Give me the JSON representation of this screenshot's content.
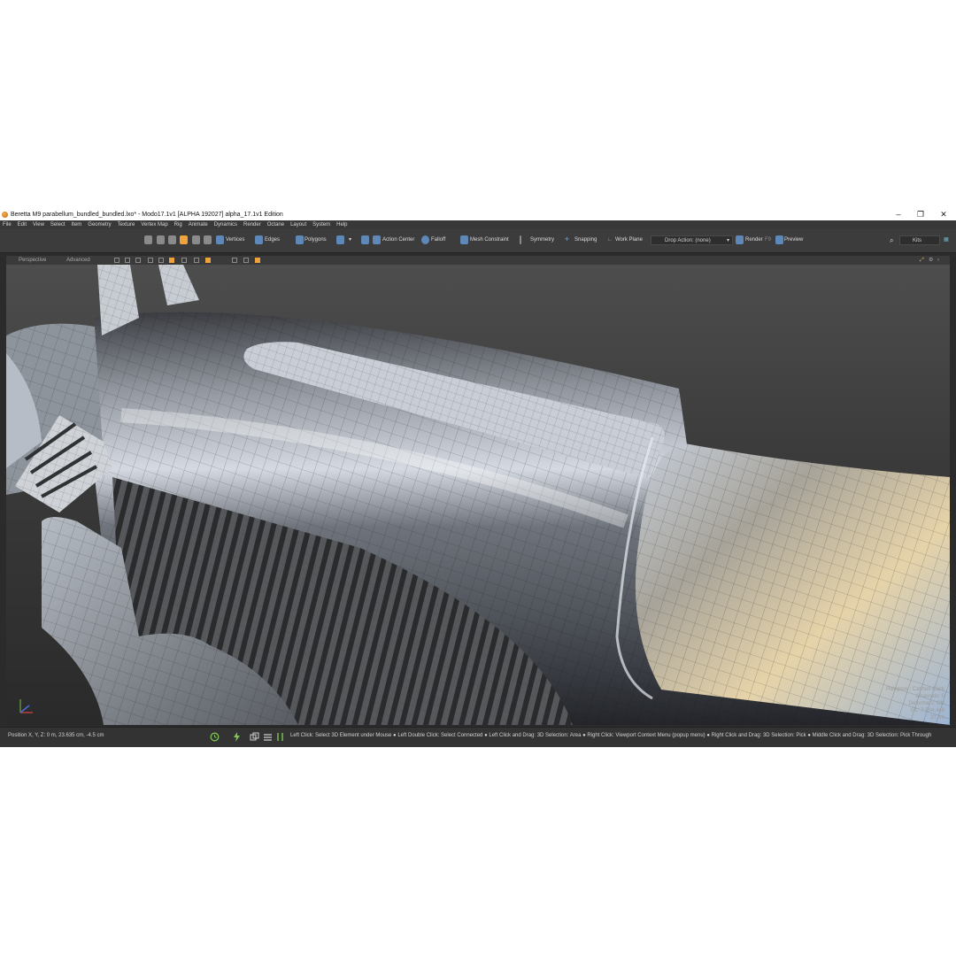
{
  "window": {
    "title": "Beretta M9 parabellum_bundled_bundled.lxo* - Modo17.1v1 [ALPHA 192027]   alpha_17.1v1 Edition",
    "minimize": "–",
    "maximize": "❐",
    "close": "✕"
  },
  "menu": [
    "File",
    "Edit",
    "View",
    "Select",
    "Item",
    "Geometry",
    "Texture",
    "Vertex Map",
    "Rig",
    "Animate",
    "Dynamics",
    "Render",
    "Octane",
    "Layout",
    "System",
    "Help"
  ],
  "toolbar": {
    "vertices": "Vertices",
    "edges": "Edges",
    "polygons": "Polygons",
    "action_center": "Action Center",
    "falloff": "Falloff",
    "mesh_constraint": "Mesh Constraint",
    "symmetry": "Symmetry",
    "snapping": "Snapping",
    "work_plane": "Work Plane",
    "drop_action": "Drop Action: (none)",
    "render": "Render",
    "render_key": "F9",
    "preview": "Preview",
    "kits": "Kits"
  },
  "viewport": {
    "view_label": "Perspective",
    "mode_label": "Advanced",
    "stats": [
      "Polygons : Catmull-Clark",
      "Channels: 0",
      "Deformers: ON",
      "GL: 7,504,448",
      "20 cm"
    ]
  },
  "status": {
    "position": "Position X, Y, Z:   0 m, 23.635 cm, -4.5 cm",
    "hint": "Left Click: Select 3D Element under Mouse ● Left Double Click: Select Connected ● Left Click and Drag: 3D Selection: Area ● Right Click: Viewport Context Menu (popup menu) ● Right Click and Drag: 3D Selection: Pick ● Middle Click and Drag: 3D Selection: Pick Through"
  },
  "colors": {
    "accent": "#f2a23a",
    "ui_dark": "#2b2b2b"
  }
}
